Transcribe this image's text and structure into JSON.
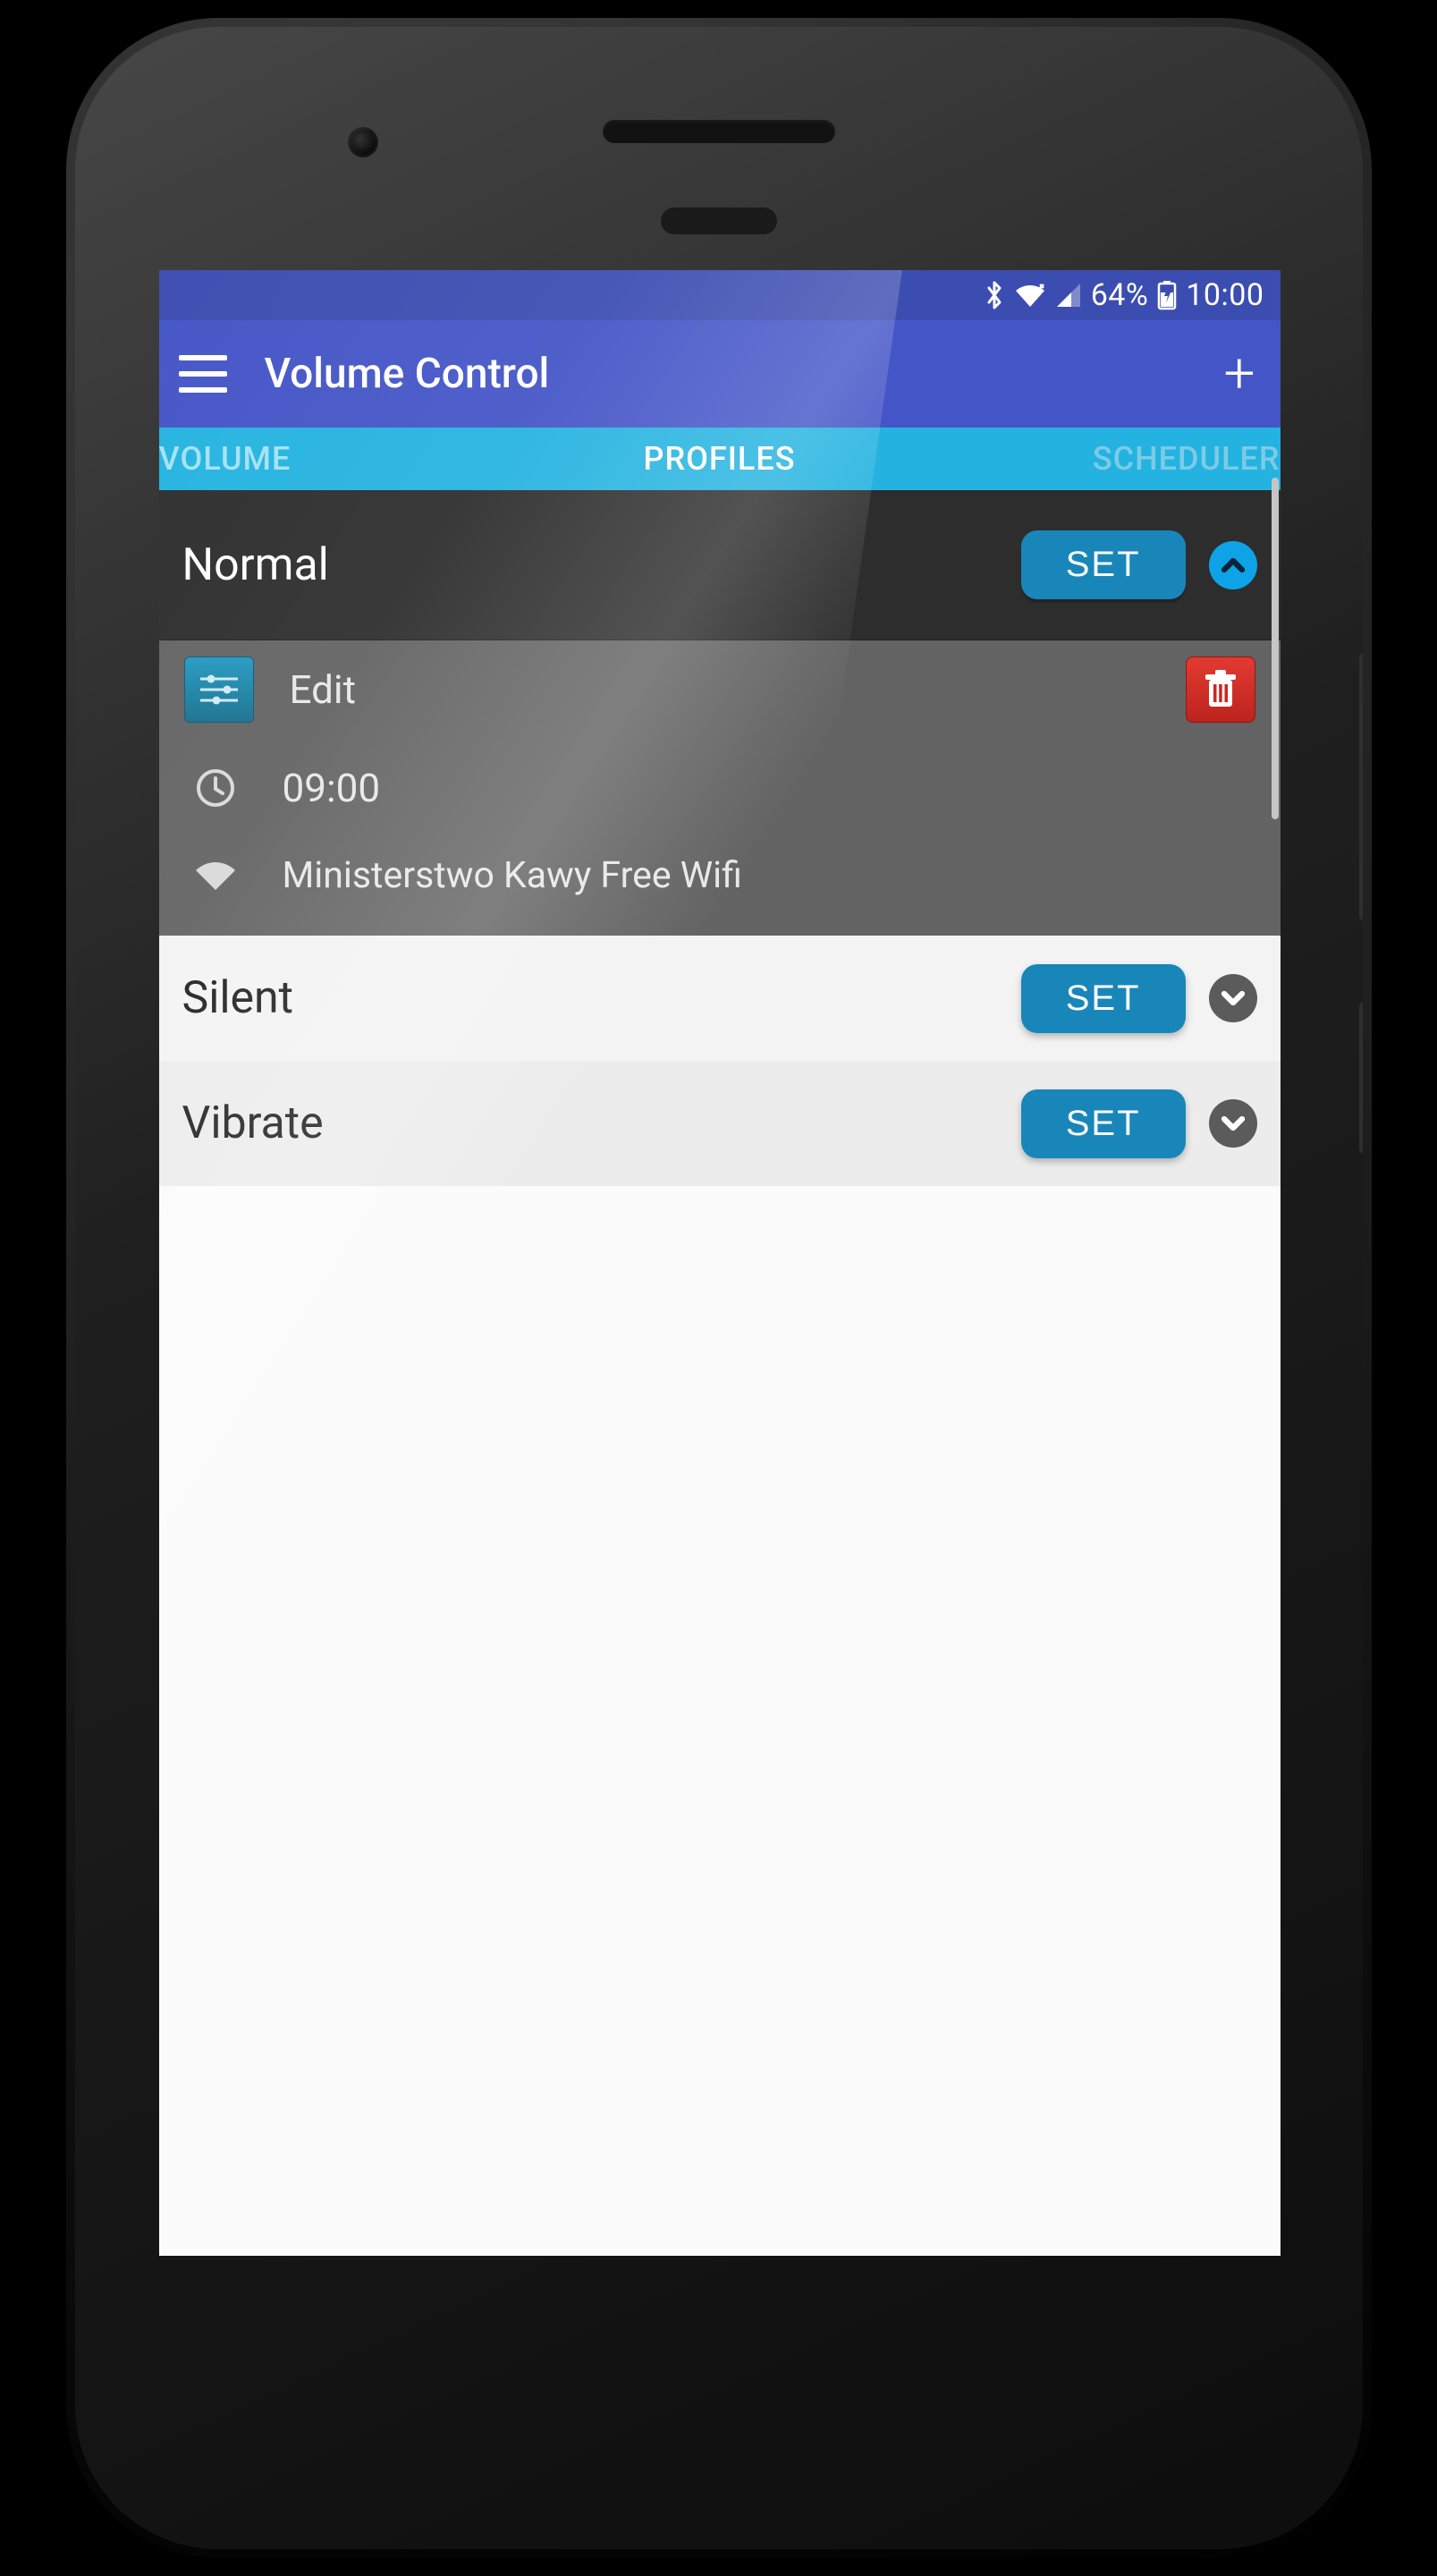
{
  "status": {
    "battery": "64%",
    "time": "10:00"
  },
  "appbar": {
    "title": "Volume Control"
  },
  "tabs": {
    "volume": "VOLUME",
    "profiles": "PROFILES",
    "scheduler": "SCHEDULER"
  },
  "profiles": {
    "normal": {
      "name": "Normal",
      "set_label": "SET",
      "edit_label": "Edit",
      "time": "09:00",
      "wifi": "Ministerstwo Kawy Free Wifi"
    },
    "silent": {
      "name": "Silent",
      "set_label": "SET"
    },
    "vibrate": {
      "name": "Vibrate",
      "set_label": "SET"
    }
  }
}
